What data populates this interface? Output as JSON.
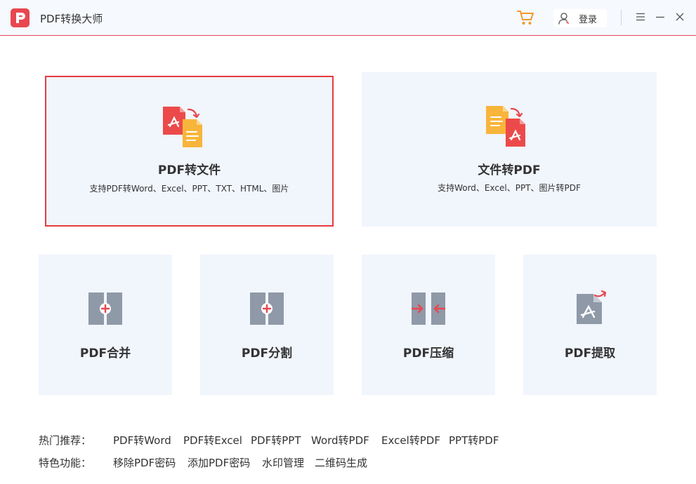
{
  "app": {
    "title": "PDF转换大师",
    "accent": "#e8474f"
  },
  "header": {
    "login_label": "登录"
  },
  "cards": {
    "pdf_to_file": {
      "title": "PDF转文件",
      "desc": "支持PDF转Word、Excel、PPT、TXT、HTML、图片"
    },
    "file_to_pdf": {
      "title": "文件转PDF",
      "desc": "支持Word、Excel、PPT、图片转PDF"
    },
    "merge": {
      "title": "PDF合并"
    },
    "split": {
      "title": "PDF分割"
    },
    "compress": {
      "title": "PDF压缩"
    },
    "extract": {
      "title": "PDF提取"
    }
  },
  "hot": {
    "label": "热门推荐：",
    "links": [
      "PDF转Word",
      "PDF转Excel",
      "PDF转PPT",
      "Word转PDF",
      "Excel转PDF",
      "PPT转PDF"
    ]
  },
  "features": {
    "label": "特色功能：",
    "links": [
      "移除PDF密码",
      "添加PDF密码",
      "水印管理",
      "二维码生成"
    ]
  },
  "icons": {
    "logo": "app-logo-icon",
    "cart": "shopping-cart-icon",
    "user": "user-icon",
    "menu": "menu-icon",
    "minimize": "minimize-icon",
    "close": "close-icon"
  }
}
